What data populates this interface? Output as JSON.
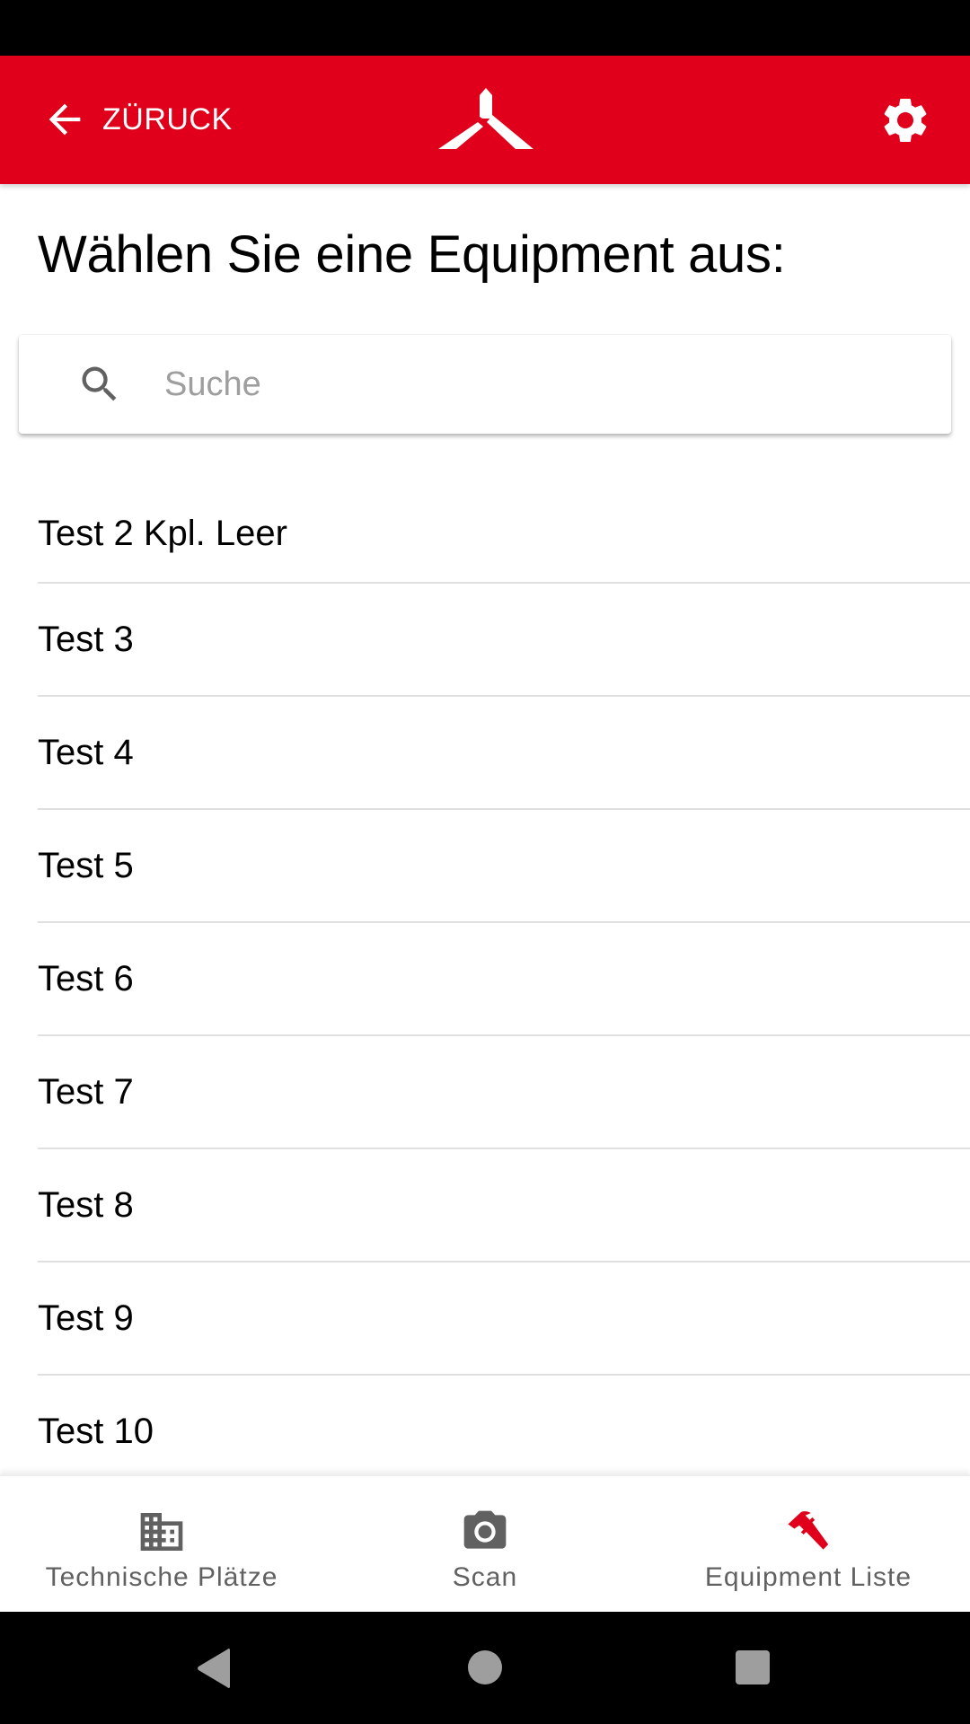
{
  "header": {
    "back_label": "ZÜRUCK",
    "logo": "company-logo-icon",
    "settings": "gear-icon",
    "brand_color": "#e0001b"
  },
  "page": {
    "title": "Wählen Sie eine Equipment aus:"
  },
  "search": {
    "placeholder": "Suche",
    "value": ""
  },
  "equipment_list": [
    {
      "label": "Test 2 Kpl. Leer"
    },
    {
      "label": "Test 3"
    },
    {
      "label": "Test 4"
    },
    {
      "label": "Test 5"
    },
    {
      "label": "Test 6"
    },
    {
      "label": "Test 7"
    },
    {
      "label": "Test 8"
    },
    {
      "label": "Test 9"
    },
    {
      "label": "Test 10"
    }
  ],
  "bottom_nav": {
    "tabs": [
      {
        "label": "Technische Plätze",
        "icon": "building-icon",
        "active": false
      },
      {
        "label": "Scan",
        "icon": "camera-icon",
        "active": false
      },
      {
        "label": "Equipment Liste",
        "icon": "hammer-icon",
        "active": true
      }
    ],
    "active_color": "#e0001b",
    "inactive_color": "#616161"
  },
  "system_nav": {
    "buttons": [
      "back",
      "home",
      "recents"
    ]
  }
}
